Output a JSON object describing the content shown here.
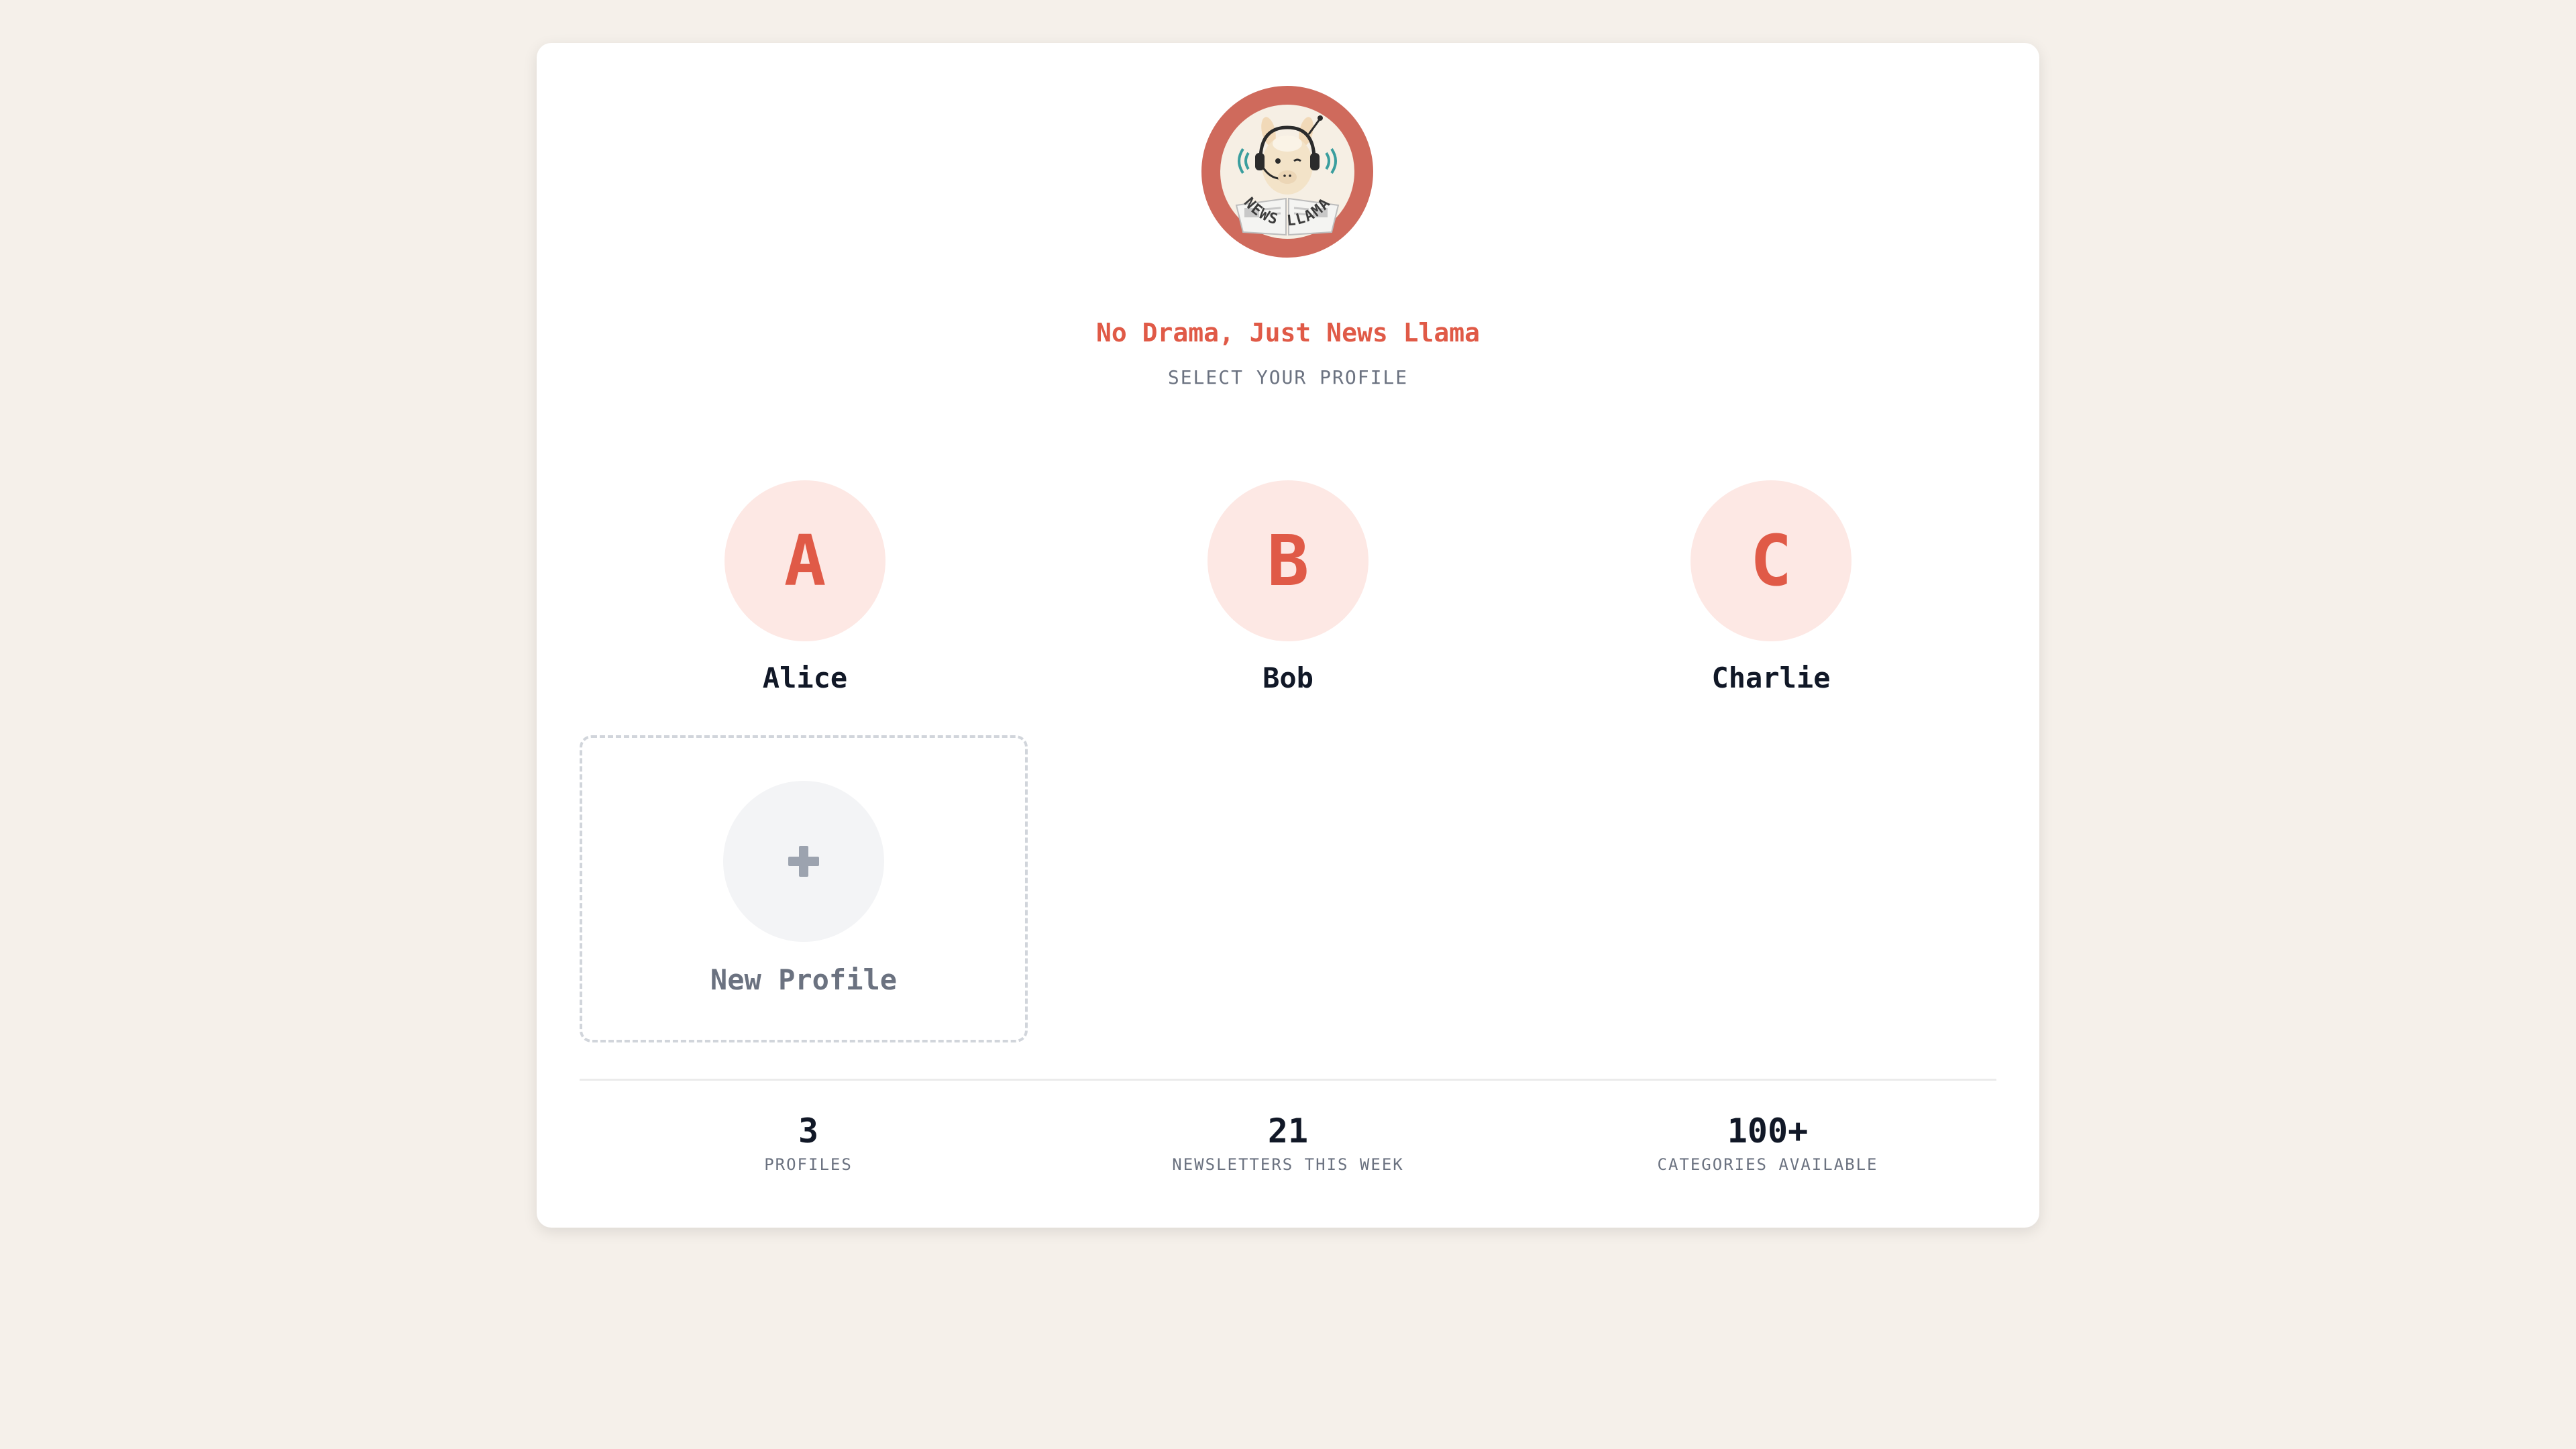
{
  "brand": {
    "logo_text": "NEWS LLAMA",
    "tagline": "No Drama, Just News Llama",
    "subtitle": "SELECT YOUR PROFILE"
  },
  "profiles": [
    {
      "initial": "A",
      "name": "Alice"
    },
    {
      "initial": "B",
      "name": "Bob"
    },
    {
      "initial": "C",
      "name": "Charlie"
    }
  ],
  "new_profile": {
    "icon": "plus-icon",
    "label": "New Profile"
  },
  "stats": [
    {
      "value": "3",
      "label": "PROFILES"
    },
    {
      "value": "21",
      "label": "NEWSLETTERS THIS WEEK"
    },
    {
      "value": "100+",
      "label": "CATEGORIES AVAILABLE"
    }
  ],
  "colors": {
    "background": "#f5f0ea",
    "accent": "#e05a47",
    "logo_ring": "#cf6a5c",
    "avatar_bg": "#fde8e4",
    "muted_text": "#6b7280",
    "dark_text": "#111827"
  }
}
